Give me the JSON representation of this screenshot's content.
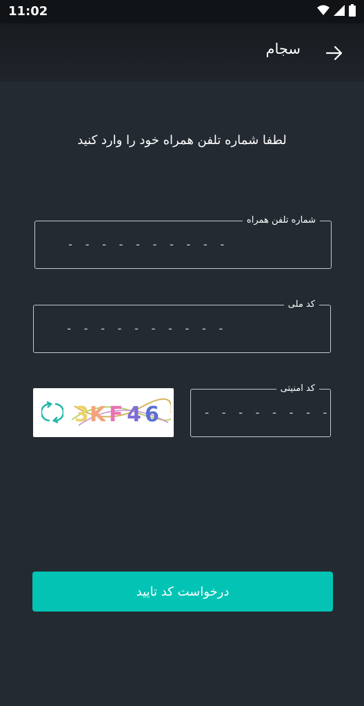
{
  "status_bar": {
    "time": "11:02",
    "icons": [
      "wifi-icon",
      "signal-icon",
      "battery-icon"
    ]
  },
  "app_bar": {
    "title": "سجام",
    "back_icon": "arrow-right-icon"
  },
  "instruction": "لطفا شماره تلفن همراه خود را وارد کنید",
  "form": {
    "phone": {
      "label": "شماره تلفن همراه",
      "placeholder": "- - - - - - - - - -",
      "value": ""
    },
    "national_code": {
      "label": "کد ملی",
      "placeholder": "- - - - - - - - - -",
      "value": ""
    },
    "security_code": {
      "label": "کد امنیتی",
      "placeholder": "- - - - - - - - - -",
      "value": ""
    },
    "captcha": {
      "refresh_icon": "refresh-icon",
      "text": "3KF46"
    }
  },
  "submit_label": "درخواست کد تایید",
  "colors": {
    "background": "#232a32",
    "app_bar": "#1a1f24",
    "accent": "#03c4b4",
    "field_border": "#c5c9cd"
  }
}
